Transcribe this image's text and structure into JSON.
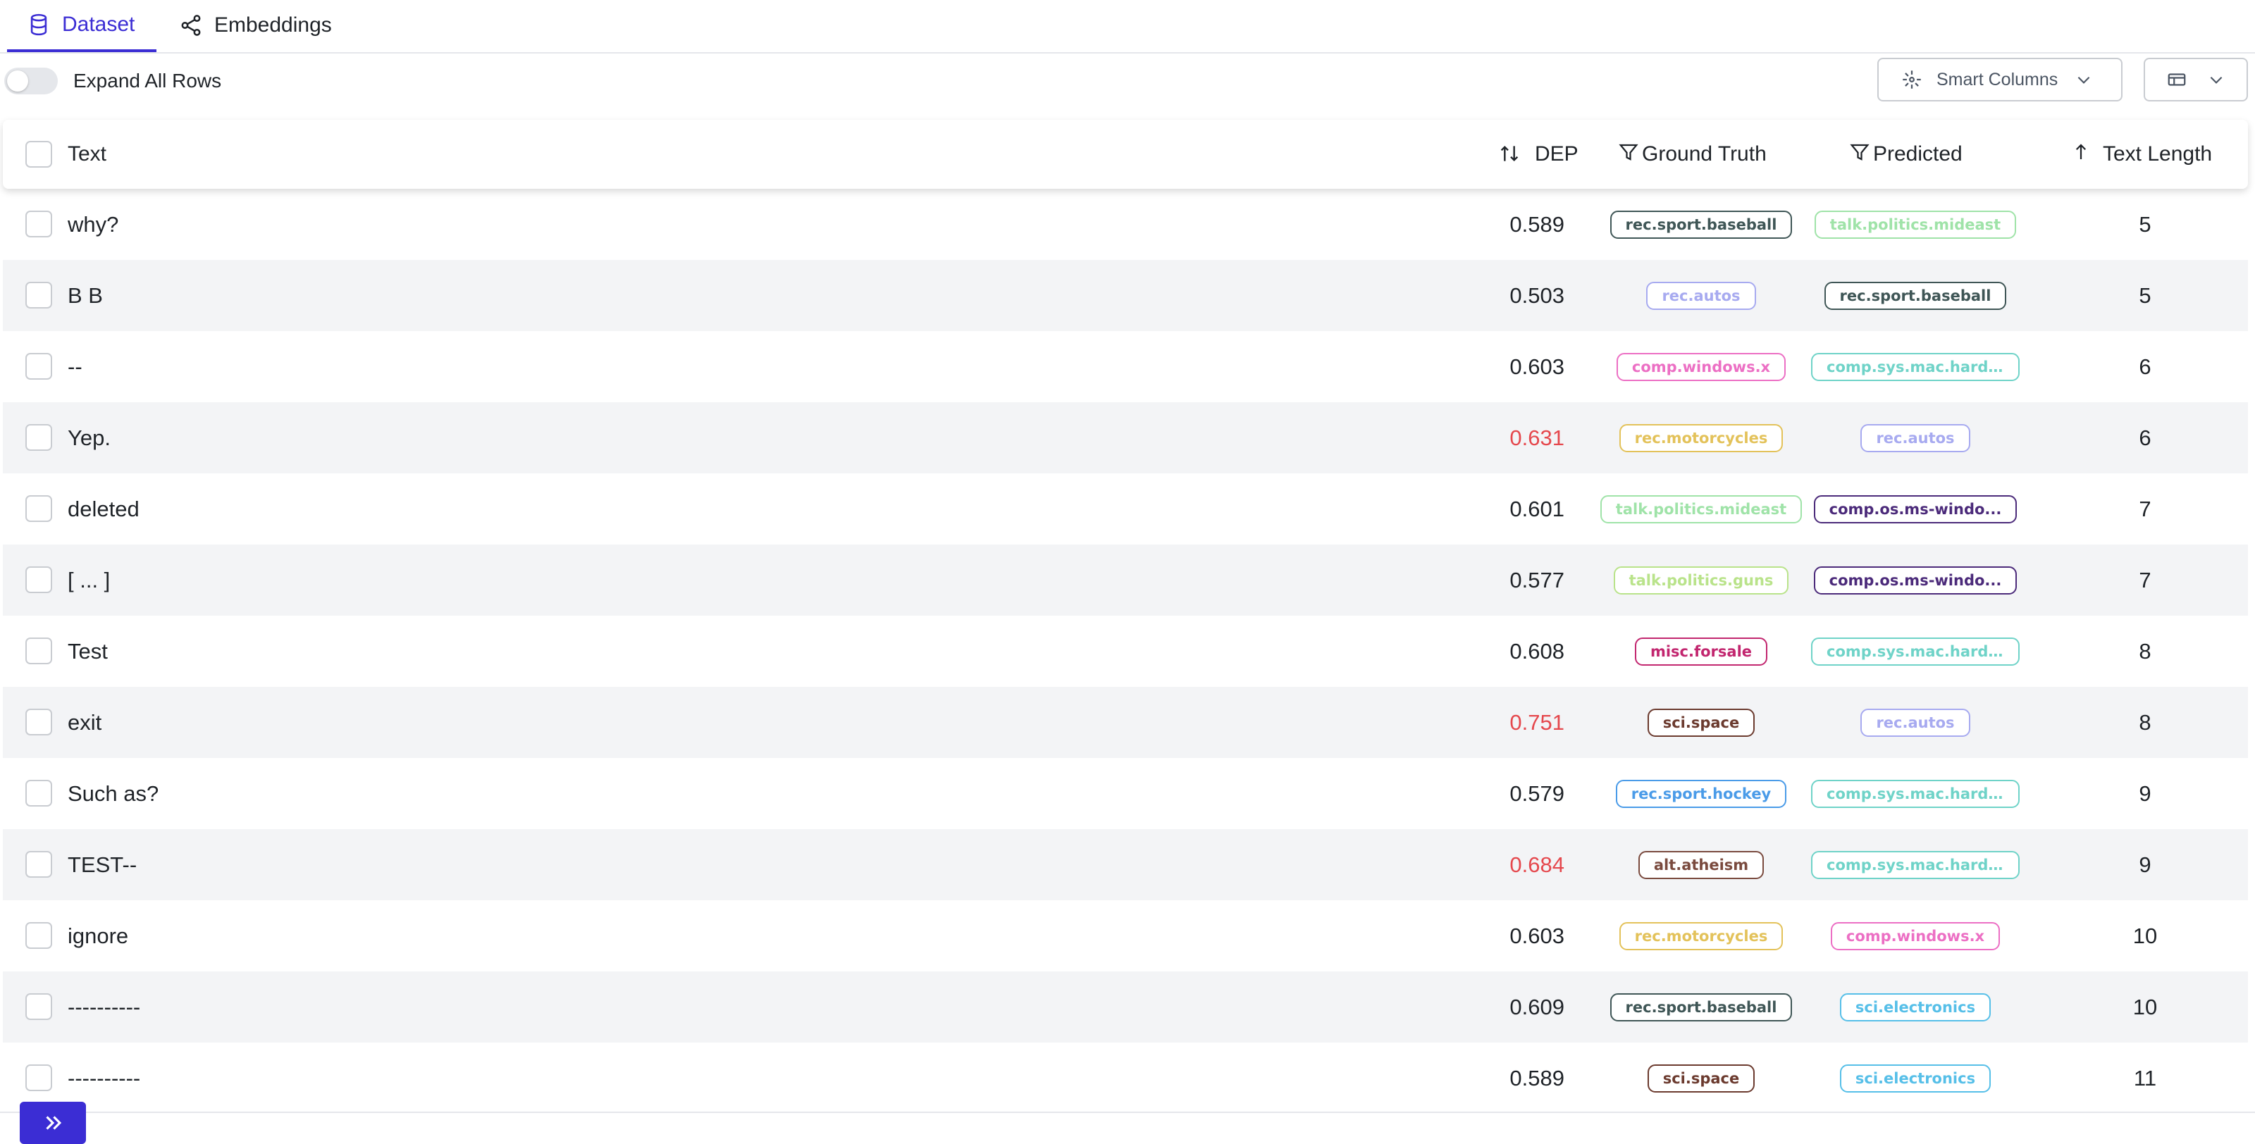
{
  "tabs": [
    {
      "label": "Dataset",
      "icon": "database-icon",
      "active": true
    },
    {
      "label": "Embeddings",
      "icon": "share-graph-icon",
      "active": false
    }
  ],
  "toolbar": {
    "expand_label": "Expand All Rows",
    "expand_enabled": false,
    "smart_columns_label": "Smart Columns"
  },
  "table": {
    "headers": {
      "text": "Text",
      "dep": "DEP",
      "ground_truth": "Ground Truth",
      "predicted": "Predicted",
      "text_length": "Text Length"
    },
    "rows": [
      {
        "text": "why?",
        "dep": "0.589",
        "dep_high": false,
        "gt": "rec.sport.baseball",
        "gt_color": "#3f5656",
        "pred": "talk.politics.mideast",
        "pred_color": "#9fe3a8",
        "len": "5"
      },
      {
        "text": "B B",
        "dep": "0.503",
        "dep_high": false,
        "gt": "rec.autos",
        "gt_color": "#a7aaf0",
        "pred": "rec.sport.baseball",
        "pred_color": "#3f5656",
        "len": "5"
      },
      {
        "text": "--",
        "dep": "0.603",
        "dep_high": false,
        "gt": "comp.windows.x",
        "gt_color": "#ec6fc4",
        "pred": "comp.sys.mac.hard...",
        "pred_color": "#6fd3c8",
        "len": "6"
      },
      {
        "text": "Yep.",
        "dep": "0.631",
        "dep_high": true,
        "gt": "rec.motorcycles",
        "gt_color": "#e3c25a",
        "pred": "rec.autos",
        "pred_color": "#a7aaf0",
        "len": "6"
      },
      {
        "text": "deleted",
        "dep": "0.601",
        "dep_high": false,
        "gt": "talk.politics.mideast",
        "gt_color": "#9fe3a8",
        "pred": "comp.os.ms-windo...",
        "pred_color": "#4b2a7a",
        "len": "7"
      },
      {
        "text": "[ ... ]",
        "dep": "0.577",
        "dep_high": false,
        "gt": "talk.politics.guns",
        "gt_color": "#b9e38a",
        "pred": "comp.os.ms-windo...",
        "pred_color": "#4b2a7a",
        "len": "7"
      },
      {
        "text": "Test",
        "dep": "0.608",
        "dep_high": false,
        "gt": "misc.forsale",
        "gt_color": "#c2266f",
        "pred": "comp.sys.mac.hard...",
        "pred_color": "#6fd3c8",
        "len": "8"
      },
      {
        "text": "exit",
        "dep": "0.751",
        "dep_high": true,
        "gt": "sci.space",
        "gt_color": "#6b3a2e",
        "pred": "rec.autos",
        "pred_color": "#a7aaf0",
        "len": "8"
      },
      {
        "text": "Such as?",
        "dep": "0.579",
        "dep_high": false,
        "gt": "rec.sport.hockey",
        "gt_color": "#4a9be8",
        "pred": "comp.sys.mac.hard...",
        "pred_color": "#6fd3c8",
        "len": "9"
      },
      {
        "text": "TEST--",
        "dep": "0.684",
        "dep_high": true,
        "gt": "alt.atheism",
        "gt_color": "#7a4a3e",
        "pred": "comp.sys.mac.hard...",
        "pred_color": "#6fd3c8",
        "len": "9"
      },
      {
        "text": "ignore",
        "dep": "0.603",
        "dep_high": false,
        "gt": "rec.motorcycles",
        "gt_color": "#e3c25a",
        "pred": "comp.windows.x",
        "pred_color": "#ec6fc4",
        "len": "10"
      },
      {
        "text": "----------",
        "dep": "0.609",
        "dep_high": false,
        "gt": "rec.sport.baseball",
        "gt_color": "#3f5656",
        "pred": "sci.electronics",
        "pred_color": "#56bfe8",
        "len": "10"
      },
      {
        "text": "----------",
        "dep": "0.589",
        "dep_high": false,
        "gt": "sci.space",
        "gt_color": "#6b3a2e",
        "pred": "sci.electronics",
        "pred_color": "#56bfe8",
        "len": "11"
      }
    ]
  },
  "colors": {
    "accent": "#3b2dd4",
    "dep_high": "#e5484d",
    "row_alt": "#f3f4f6"
  },
  "sidebar_toggle_icon": "double-chevron-right-icon"
}
